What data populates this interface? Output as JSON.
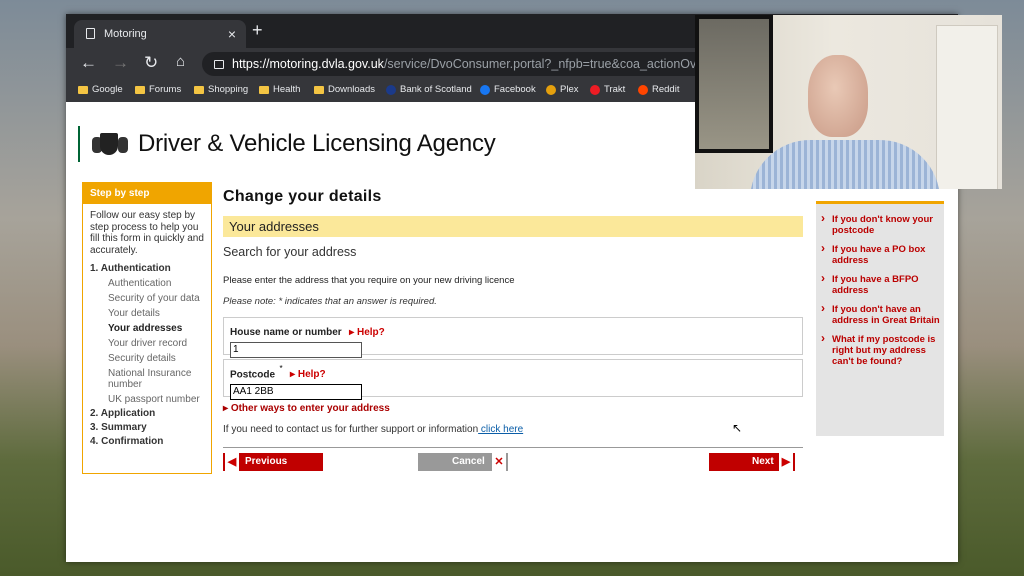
{
  "browser": {
    "tab_title": "Motoring",
    "url_host": "https://motoring.dvla.gov.uk",
    "url_path": "/service/DvoConsumer.portal?_nfpb=true&coa_actionOverrid",
    "bookmarks": [
      "Google",
      "Forums",
      "Shopping",
      "Health",
      "Downloads",
      "Bank of Scotland",
      "Facebook",
      "Plex",
      "Trakt",
      "Reddit"
    ]
  },
  "header": {
    "agency_name": "Driver & Vehicle Licensing Agency"
  },
  "sidebar": {
    "title": "Step by step",
    "intro": "Follow our easy step by step process to help you fill this form in quickly and accurately.",
    "steps": {
      "authentication": "1. Authentication",
      "auth_sub": [
        "Authentication",
        "Security of your data",
        "Your details",
        "Your addresses",
        "Your driver record",
        "Security details",
        "National Insurance number",
        "UK passport number"
      ],
      "application": "2. Application",
      "summary": "3. Summary",
      "confirmation": "4. Confirmation"
    }
  },
  "main": {
    "title": "Change your details",
    "section": "Your addresses",
    "subtitle": "Search for your address",
    "instruction": "Please enter the address that you require on your new driving licence",
    "note": "Please note: * indicates that an answer is required.",
    "house_label": "House name or number",
    "house_value": "1",
    "postcode_label": "Postcode",
    "required_mark": "*",
    "postcode_value": "AA1 2BB",
    "help": "Help?",
    "other_ways": "Other ways to enter your address",
    "contact_text": "If you need to contact us for further support or information",
    "contact_link": " click here",
    "previous": "Previous",
    "cancel": "Cancel",
    "next": "Next"
  },
  "right_links": [
    "If you don't know your postcode",
    "If you have a PO box address",
    "If you have a BFPO address",
    "If you don't have an address in Great Britain",
    "What if my postcode is right but my address can't be found?"
  ],
  "colors": {
    "accent": "#f0a500",
    "button_red": "#c00000",
    "cancel_grey": "#999999",
    "highlight": "#fbe89a"
  }
}
